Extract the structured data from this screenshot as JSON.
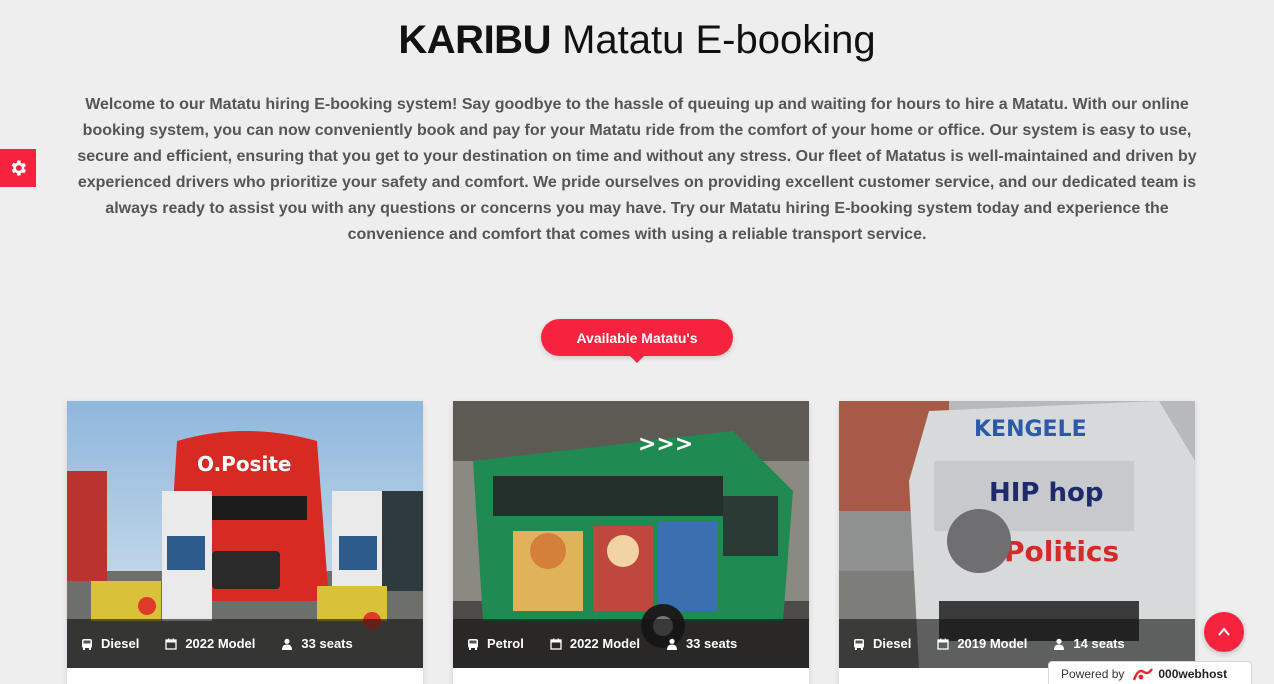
{
  "header": {
    "title_bold": "KARIBU",
    "title_light": "Matatu E-booking"
  },
  "intro": {
    "text": "Welcome to our Matatu hiring E-booking system! Say goodbye to the hassle of queuing up and waiting for hours to hire a Matatu. With our online booking system, you can now conveniently book and pay for your Matatu ride from the comfort of your home or office. Our system is easy to use, secure and efficient, ensuring that you get to your destination on time and without any stress. Our fleet of Matatus is well-maintained and driven by experienced drivers who prioritize your safety and comfort. We pride ourselves on providing excellent customer service, and our dedicated team is always ready to assist you with any questions or concerns you may have. Try our Matatu hiring E-booking system today and experience the convenience and comfort that comes with using a reliable transport service."
  },
  "section": {
    "label": "Available Matatu's"
  },
  "cards": [
    {
      "fuel": "Diesel",
      "model": "2022 Model",
      "seats": "33 seats"
    },
    {
      "fuel": "Petrol",
      "model": "2022 Model",
      "seats": "33 seats"
    },
    {
      "fuel": "Diesel",
      "model": "2019 Model",
      "seats": "14 seats"
    }
  ],
  "footer": {
    "powered_by": "Powered by",
    "host": "000webhost"
  },
  "colors": {
    "accent": "#f5233e",
    "background": "#efeeef",
    "text_muted": "#555555"
  },
  "icons": {
    "settings": "gear-icon",
    "scroll_top": "chevron-up-icon",
    "fuel": "bus-icon",
    "model": "calendar-icon",
    "seats": "user-icon"
  }
}
